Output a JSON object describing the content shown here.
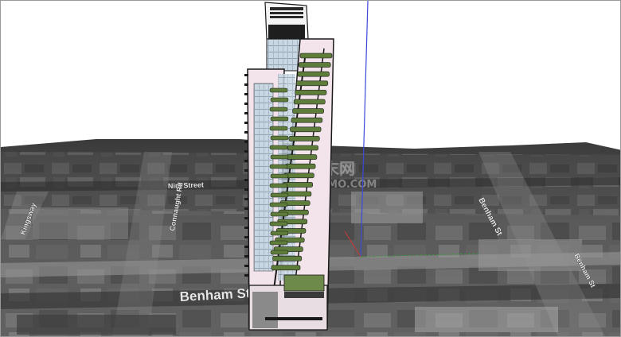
{
  "viewport": {
    "background": "#ffffff",
    "terrain_color": "#5a5a5a"
  },
  "map": {
    "street_labels": {
      "benham_street": "Benham Street",
      "benham_st_right": "Benham St",
      "nim_street_left": "Nim Street",
      "upper_left_street": "Kingsway",
      "rotated_left": "Connaught Rd",
      "rotated_right": "Benham St"
    },
    "watermark": {
      "chinese": "知末网",
      "latin": "ZHIMO.COM"
    }
  },
  "axes": {
    "blue": "#3b4bd8",
    "red": "#c43a3a",
    "green": "#3a9a3a"
  },
  "building": {
    "balcony_color": "#5e7d3a",
    "facade_color": "#f2e4ea",
    "glass_color": "#c9d7e2"
  }
}
